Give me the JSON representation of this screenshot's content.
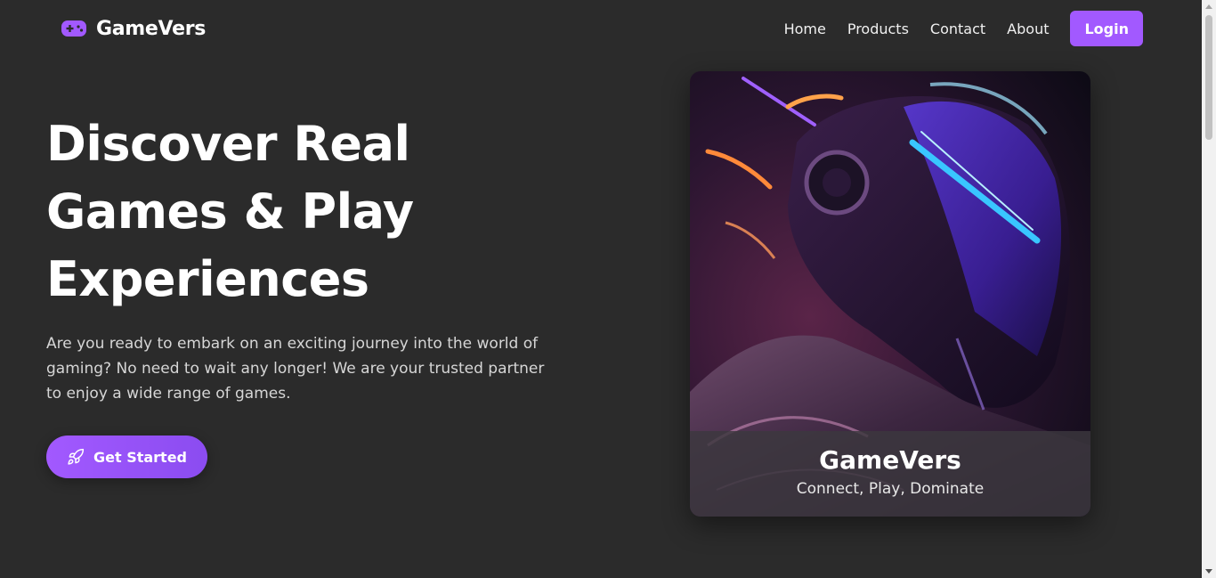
{
  "navbar": {
    "brand": {
      "name": "GameVers",
      "icon": "gamepad-icon"
    },
    "links": [
      "Home",
      "Products",
      "Contact",
      "About"
    ],
    "login_label": "Login"
  },
  "hero": {
    "title_lines": [
      "Discover Real",
      "Games & Play",
      "Experiences"
    ],
    "description": "Are you ready to embark on an exciting journey into the world of gaming? No need to wait any longer! We are your trusted partner to enjoy a wide range of games.",
    "cta": {
      "label": "Get Started",
      "icon": "rocket-icon"
    }
  },
  "card": {
    "image": "cyber-helmet-image",
    "title": "GameVers",
    "subtitle": "Connect, Play, Dominate"
  },
  "colors": {
    "background": "#2b2b2b",
    "accent": "#a259ff",
    "text": "#ffffff",
    "muted_text": "#d6d6d6"
  }
}
